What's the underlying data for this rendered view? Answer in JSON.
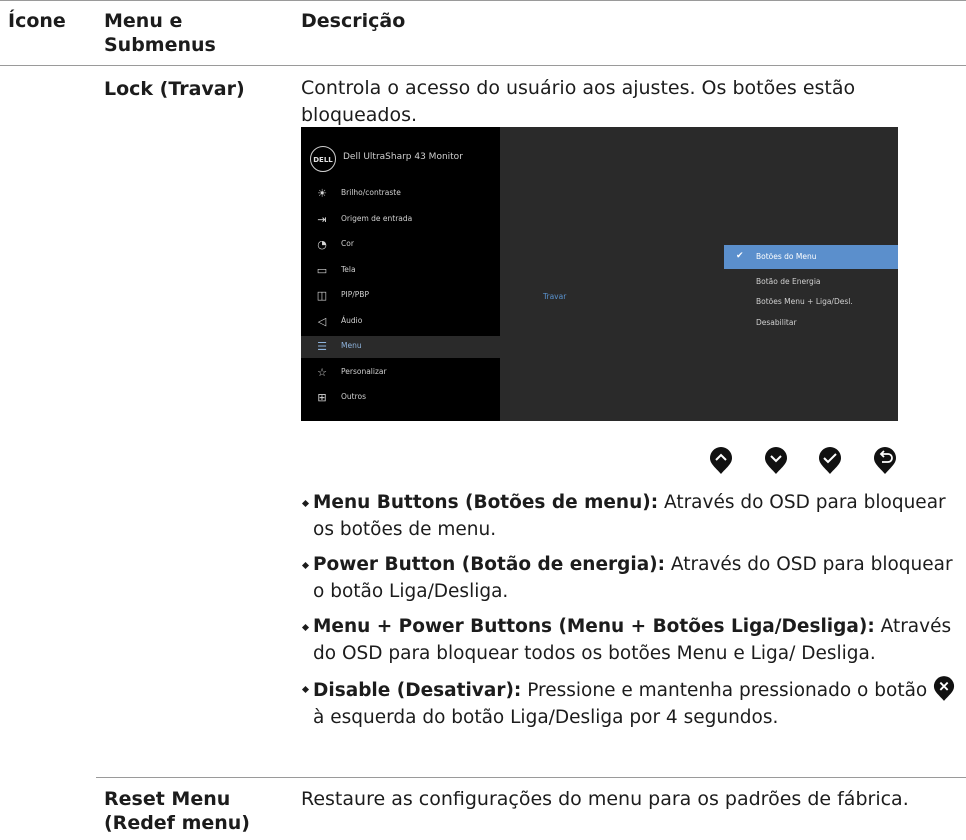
{
  "header": {
    "col1": "Ícone",
    "col2": "Menu e Submenus",
    "col3": "Descrição"
  },
  "lock_row": {
    "name": "Lock (Travar)",
    "description": "Controla o acesso do usuário aos ajustes. Os botões estão bloqueados.",
    "osd": {
      "logo": "DELL",
      "title": "Dell UltraSharp 43 Monitor",
      "menu_items": [
        {
          "label": "Brilho/contraste",
          "icon": "brightness-icon"
        },
        {
          "label": "Origem de entrada",
          "icon": "input-source-icon"
        },
        {
          "label": "Cor",
          "icon": "color-palette-icon"
        },
        {
          "label": "Tela",
          "icon": "display-icon"
        },
        {
          "label": "PIP/PBP",
          "icon": "pip-icon"
        },
        {
          "label": "Áudio",
          "icon": "speaker-icon"
        },
        {
          "label": "Menu",
          "icon": "menu-icon",
          "active": true
        },
        {
          "label": "Personalizar",
          "icon": "star-icon"
        },
        {
          "label": "Outros",
          "icon": "others-icon"
        }
      ],
      "middle_label": "Travar",
      "options": [
        {
          "label": "Botões do Menu",
          "selected": true
        },
        {
          "label": "Botão de Energia"
        },
        {
          "label": "Botões Menu + Liga/Desl."
        },
        {
          "label": "Desabilitar"
        }
      ],
      "accent_color": "#5b8fcc"
    },
    "buttons": [
      "up-arrow-icon",
      "down-arrow-icon",
      "check-icon",
      "back-icon"
    ],
    "bullets": [
      {
        "bold": "Menu Buttons (Botões de menu):",
        "text": " Através do OSD para bloquear os botões de menu."
      },
      {
        "bold": "Power Button (Botão de energia):",
        "text": " Através do OSD para bloquear o botão Liga/Desliga."
      },
      {
        "bold": "Menu + Power Buttons (Menu + Botões Liga/Desliga):",
        "text": " Através do OSD para bloquear todos os botões Menu e Liga/ Desliga."
      },
      {
        "bold": "Disable (Desativar):",
        "text_before": " Pressione e mantenha pressionado o botão ",
        "text_after": " à esquerda do botão Liga/Desliga por 4 segundos."
      }
    ]
  },
  "reset_row": {
    "name": "Reset Menu (Redef menu)",
    "description": "Restaure as configurações do menu para os padrões de fábrica."
  }
}
